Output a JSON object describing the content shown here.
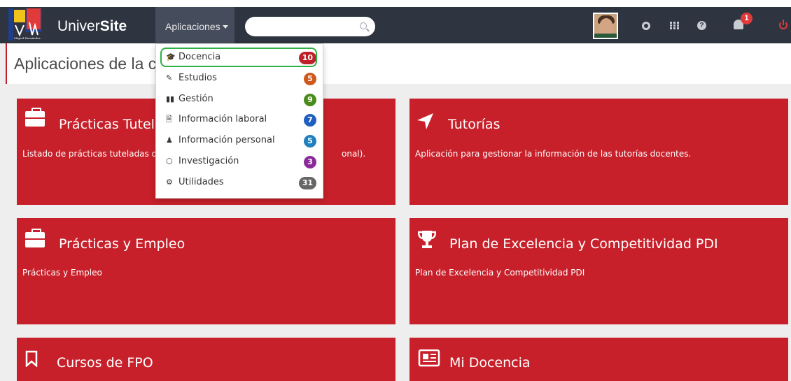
{
  "brand": {
    "name_light": "Univer",
    "name_bold": "Site"
  },
  "nav": {
    "apps_label": "Aplicaciones",
    "search_placeholder": "",
    "notifications_count": "1"
  },
  "page": {
    "title": "Aplicaciones de la ca"
  },
  "dropdown": {
    "items": [
      {
        "icon": "graduation-cap-icon",
        "label": "Docencia",
        "count": "10",
        "color": "#c0202a"
      },
      {
        "icon": "edit-icon",
        "label": "Estudios",
        "count": "5",
        "color": "#d0581c"
      },
      {
        "icon": "bar-chart-icon",
        "label": "Gestión",
        "count": "9",
        "color": "#4a8c1c"
      },
      {
        "icon": "documents-icon",
        "label": "Información laboral",
        "count": "7",
        "color": "#1f5fbf"
      },
      {
        "icon": "user-icon",
        "label": "Información personal",
        "count": "5",
        "color": "#1f7fbf"
      },
      {
        "icon": "hexagon-icon",
        "label": "Investigación",
        "count": "3",
        "color": "#8a2a9a"
      },
      {
        "icon": "cogs-icon",
        "label": "Utilidades",
        "count": "31",
        "color": "#666666"
      }
    ]
  },
  "cards": [
    {
      "title": "Prácticas Tutelac",
      "desc": "Listado de prácticas tuteladas de",
      "desc_tail": "onal).",
      "icon": "briefcase-icon"
    },
    {
      "title": "Tutorías",
      "desc": "Aplicación para gestionar la información de las tutorías docentes.",
      "icon": "location-arrow-icon"
    },
    {
      "title": "Prácticas y Empleo",
      "desc": "Prácticas y Empleo",
      "icon": "briefcase-icon"
    },
    {
      "title": "Plan de Excelencia y Competitividad PDI",
      "desc": "Plan de Excelencia y Competitividad PDI",
      "icon": "trophy-icon"
    },
    {
      "title": "Cursos de FPO",
      "desc": "",
      "icon": "bookmark-icon"
    },
    {
      "title": "Mi Docencia",
      "desc": "",
      "icon": "newspaper-icon"
    }
  ]
}
